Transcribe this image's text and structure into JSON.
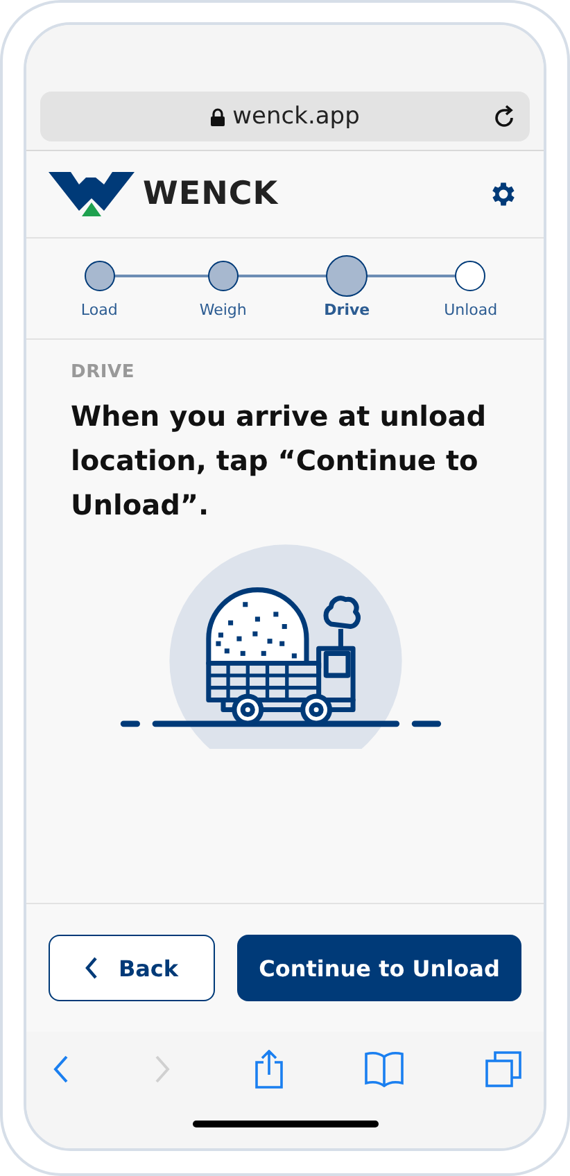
{
  "browser": {
    "address": "wenck.app",
    "secure": true
  },
  "header": {
    "brand": "WENCK"
  },
  "steps": [
    {
      "label": "Load",
      "completed": true,
      "selected": false
    },
    {
      "label": "Weigh",
      "completed": true,
      "selected": false
    },
    {
      "label": "Drive",
      "completed": false,
      "selected": true
    },
    {
      "label": "Unload",
      "completed": false,
      "selected": false
    }
  ],
  "content": {
    "eyebrow": "DRIVE",
    "instruction": "When you arrive at unload location, tap “Continue to Unload”."
  },
  "actions": [
    {
      "label": "Back",
      "kind": "secondary"
    },
    {
      "label": "Continue to Unload",
      "kind": "primary"
    }
  ],
  "toolbar": {
    "back_disabled": false,
    "forward_disabled": true
  }
}
